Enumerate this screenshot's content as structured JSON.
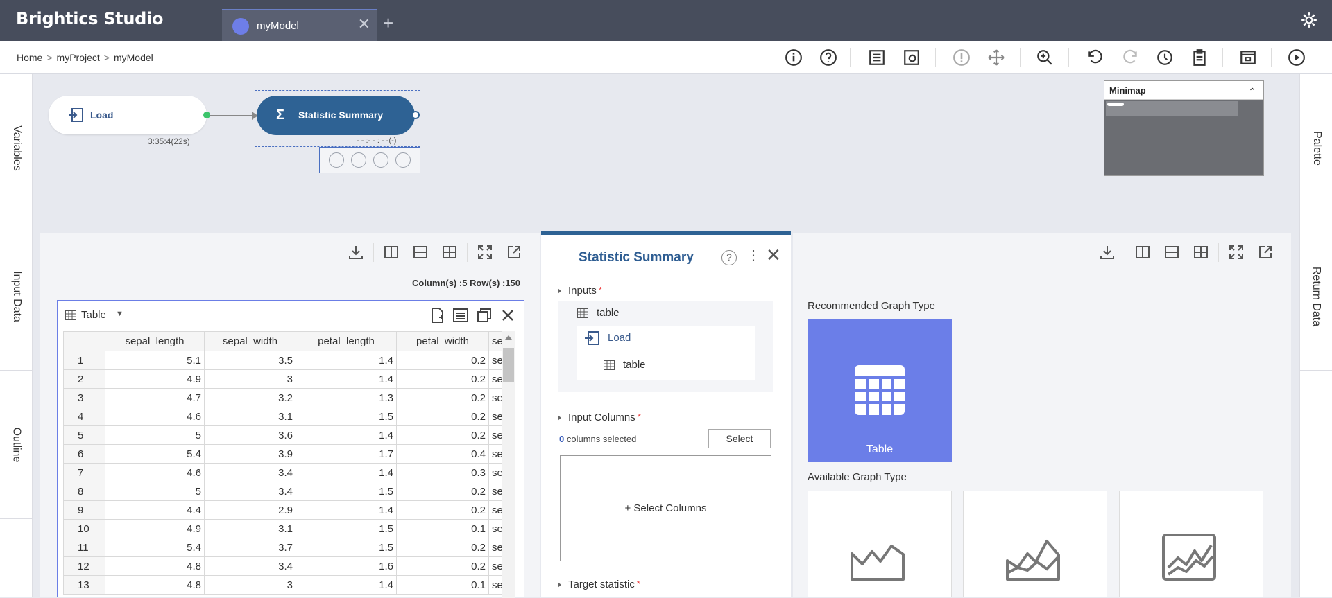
{
  "app": {
    "title": "Brightics Studio"
  },
  "tabs": [
    {
      "label": "myModel",
      "close": "✕"
    }
  ],
  "tab_add": "+",
  "breadcrumb": [
    "Home",
    "myProject",
    "myModel"
  ],
  "breadcrumb_sep": ">",
  "side_left": [
    "Variables",
    "Input Data",
    "Outline"
  ],
  "side_right": [
    "Palette",
    "Return Data"
  ],
  "nodes": {
    "load": {
      "label": "Load",
      "time": "3:35:4(22s)"
    },
    "stat": {
      "label": "Statistic Summary",
      "icon": "Σ",
      "time": "- - :- - : - -(-)"
    }
  },
  "minimap": {
    "title": "Minimap",
    "toggle": "⌃"
  },
  "left_panel": {
    "counts": "Column(s) :5   Row(s) :150",
    "table_title": "Table",
    "columns": [
      "sepal_length",
      "sepal_width",
      "petal_length",
      "petal_width"
    ],
    "trunc_col": "se",
    "rows": [
      [
        "1",
        "5.1",
        "3.5",
        "1.4",
        "0.2"
      ],
      [
        "2",
        "4.9",
        "3",
        "1.4",
        "0.2"
      ],
      [
        "3",
        "4.7",
        "3.2",
        "1.3",
        "0.2"
      ],
      [
        "4",
        "4.6",
        "3.1",
        "1.5",
        "0.2"
      ],
      [
        "5",
        "5",
        "3.6",
        "1.4",
        "0.2"
      ],
      [
        "6",
        "5.4",
        "3.9",
        "1.7",
        "0.4"
      ],
      [
        "7",
        "4.6",
        "3.4",
        "1.4",
        "0.3"
      ],
      [
        "8",
        "5",
        "3.4",
        "1.5",
        "0.2"
      ],
      [
        "9",
        "4.4",
        "2.9",
        "1.4",
        "0.2"
      ],
      [
        "10",
        "4.9",
        "3.1",
        "1.5",
        "0.1"
      ],
      [
        "11",
        "5.4",
        "3.7",
        "1.5",
        "0.2"
      ],
      [
        "12",
        "4.8",
        "3.4",
        "1.6",
        "0.2"
      ],
      [
        "13",
        "4.8",
        "3",
        "1.4",
        "0.1"
      ]
    ]
  },
  "mid_panel": {
    "title": "Statistic Summary",
    "help": "?",
    "more": "⋮",
    "close": "✕",
    "inputs_label": "Inputs",
    "input_table": "table",
    "input_source": "Load",
    "input_source_table": "table",
    "input_columns_label": "Input Columns",
    "columns_selected_count": "0",
    "columns_selected_text": "columns selected",
    "select_button": "Select",
    "select_columns_area": "+ Select Columns",
    "target_statistic_label": "Target statistic",
    "required_mark": "*"
  },
  "right_panel": {
    "recommended_label": "Recommended Graph Type",
    "recommended_card": "Table",
    "available_label": "Available Graph Type"
  },
  "colors": {
    "topbar": "#474d5c",
    "accent": "#2e6294",
    "card": "#6b7ee8"
  }
}
